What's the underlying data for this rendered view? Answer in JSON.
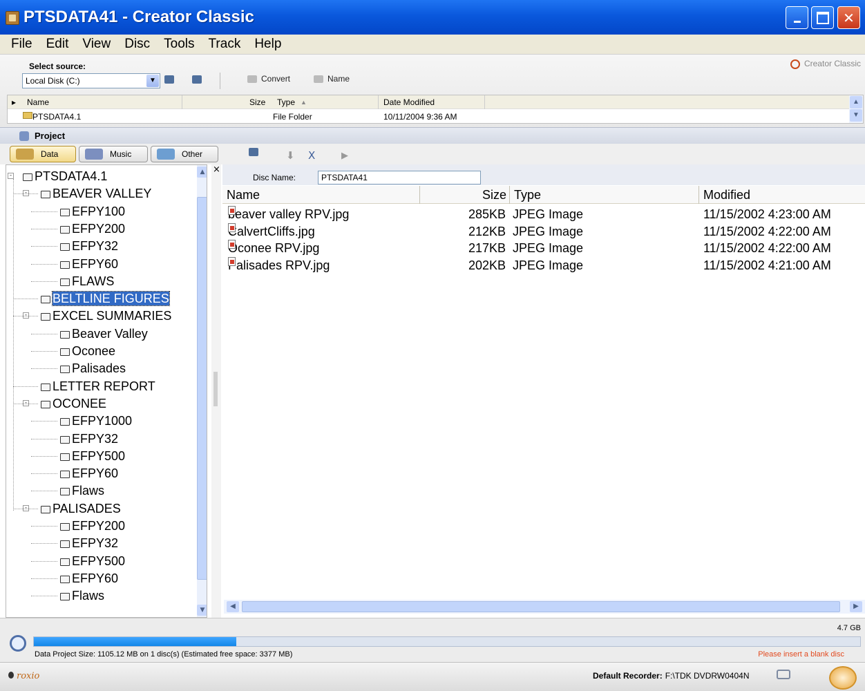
{
  "window": {
    "title": "PTSDATA41 - Creator Classic",
    "min_label": "",
    "max_label": "",
    "close_label": "✕"
  },
  "menu": [
    "File",
    "Edit",
    "View",
    "Disc",
    "Tools",
    "Track",
    "Help"
  ],
  "source": {
    "label": "Select source:",
    "brand": "Creator Classic",
    "drive": "Local Disk (C:)",
    "buttons": {
      "convert": "Convert",
      "name": "Name"
    },
    "list": {
      "columns": {
        "name": "Name",
        "size": "Size",
        "type": "Type",
        "date": "Date Modified"
      },
      "sort_indicator": "▲",
      "row": {
        "name": "PTSDATA4.1",
        "size": "",
        "type": "File Folder",
        "date": "10/11/2004 9:36 AM"
      }
    }
  },
  "project": {
    "label": "Project",
    "tabs": {
      "data": "Data",
      "music": "Music",
      "other": "Other"
    },
    "tools": {
      "delete": "X",
      "play": "▶"
    }
  },
  "tree": [
    {
      "label": "PTSDATA4.1",
      "level": 0,
      "expander": "-"
    },
    {
      "label": "BEAVER VALLEY",
      "level": 1,
      "expander": "-"
    },
    {
      "label": "EFPY100",
      "level": 2
    },
    {
      "label": "EFPY200",
      "level": 2
    },
    {
      "label": "EFPY32",
      "level": 2
    },
    {
      "label": "EFPY60",
      "level": 2
    },
    {
      "label": "FLAWS",
      "level": 2
    },
    {
      "label": "BELTLINE FIGURES",
      "level": 1,
      "selected": true
    },
    {
      "label": "EXCEL SUMMARIES",
      "level": 1,
      "expander": "-"
    },
    {
      "label": "Beaver Valley",
      "level": 2
    },
    {
      "label": "Oconee",
      "level": 2
    },
    {
      "label": "Palisades",
      "level": 2
    },
    {
      "label": "LETTER REPORT",
      "level": 1
    },
    {
      "label": "OCONEE",
      "level": 1,
      "expander": "-"
    },
    {
      "label": "EFPY1000",
      "level": 2
    },
    {
      "label": "EFPY32",
      "level": 2
    },
    {
      "label": "EFPY500",
      "level": 2
    },
    {
      "label": "EFPY60",
      "level": 2
    },
    {
      "label": "Flaws",
      "level": 2
    },
    {
      "label": "PALISADES",
      "level": 1,
      "expander": "-"
    },
    {
      "label": "EFPY200",
      "level": 2
    },
    {
      "label": "EFPY32",
      "level": 2
    },
    {
      "label": "EFPY500",
      "level": 2
    },
    {
      "label": "EFPY60",
      "level": 2
    },
    {
      "label": "Flaws",
      "level": 2
    }
  ],
  "disc": {
    "label": "Disc Name:",
    "value": "PTSDATA41"
  },
  "files": {
    "columns": {
      "name": "Name",
      "size": "Size",
      "type": "Type",
      "modified": "Modified"
    },
    "rows": [
      {
        "name": "beaver valley RPV.jpg",
        "size": "285KB",
        "type": "JPEG Image",
        "modified": "11/15/2002 4:23:00 AM"
      },
      {
        "name": "CalvertCliffs.jpg",
        "size": "212KB",
        "type": "JPEG Image",
        "modified": "11/15/2002 4:22:00 AM"
      },
      {
        "name": "Oconee RPV.jpg",
        "size": "217KB",
        "type": "JPEG Image",
        "modified": "11/15/2002 4:22:00 AM"
      },
      {
        "name": "Palisades RPV.jpg",
        "size": "202KB",
        "type": "JPEG Image",
        "modified": "11/15/2002 4:21:00 AM"
      }
    ]
  },
  "capacity": {
    "total": "4.7 GB",
    "used_fraction": 0.245,
    "info": "Data Project Size: 1105.12 MB  on 1 disc(s)  (Estimated free space: 3377 MB)",
    "warning": "Please insert a blank disc"
  },
  "status": {
    "brand": "roxio",
    "recorder_label": "Default Recorder:",
    "recorder_value": "F:\\TDK DVDRW0404N"
  }
}
